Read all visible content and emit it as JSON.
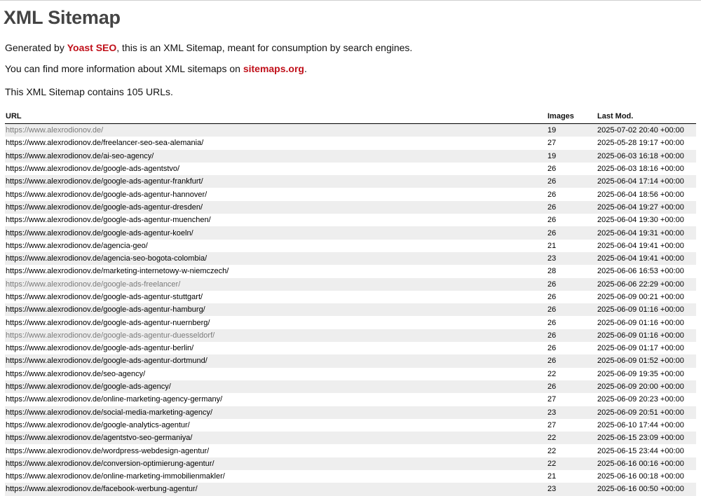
{
  "title": "XML Sitemap",
  "intro": {
    "generated_prefix": "Generated by ",
    "generator_link": "Yoast SEO",
    "generated_suffix": ", this is an XML Sitemap, meant for consumption by search engines.",
    "info_prefix": "You can find more information about XML sitemaps on ",
    "info_link": "sitemaps.org",
    "info_suffix": ".",
    "count_text": "This XML Sitemap contains 105 URLs."
  },
  "table": {
    "headers": {
      "url": "URL",
      "images": "Images",
      "lastmod": "Last Mod."
    },
    "rows": [
      {
        "url": "https://www.alexrodionov.de/",
        "images": "19",
        "lastmod": "2025-07-02 20:40 +00:00",
        "visited": true
      },
      {
        "url": "https://www.alexrodionov.de/freelancer-seo-sea-alemania/",
        "images": "27",
        "lastmod": "2025-05-28 19:17 +00:00",
        "visited": false
      },
      {
        "url": "https://www.alexrodionov.de/ai-seo-agency/",
        "images": "19",
        "lastmod": "2025-06-03 16:18 +00:00",
        "visited": false
      },
      {
        "url": "https://www.alexrodionov.de/google-ads-agentstvo/",
        "images": "26",
        "lastmod": "2025-06-03 18:16 +00:00",
        "visited": false
      },
      {
        "url": "https://www.alexrodionov.de/google-ads-agentur-frankfurt/",
        "images": "26",
        "lastmod": "2025-06-04 17:14 +00:00",
        "visited": false
      },
      {
        "url": "https://www.alexrodionov.de/google-ads-agentur-hannover/",
        "images": "26",
        "lastmod": "2025-06-04 18:56 +00:00",
        "visited": false
      },
      {
        "url": "https://www.alexrodionov.de/google-ads-agentur-dresden/",
        "images": "26",
        "lastmod": "2025-06-04 19:27 +00:00",
        "visited": false
      },
      {
        "url": "https://www.alexrodionov.de/google-ads-agentur-muenchen/",
        "images": "26",
        "lastmod": "2025-06-04 19:30 +00:00",
        "visited": false
      },
      {
        "url": "https://www.alexrodionov.de/google-ads-agentur-koeln/",
        "images": "26",
        "lastmod": "2025-06-04 19:31 +00:00",
        "visited": false
      },
      {
        "url": "https://www.alexrodionov.de/agencia-geo/",
        "images": "21",
        "lastmod": "2025-06-04 19:41 +00:00",
        "visited": false
      },
      {
        "url": "https://www.alexrodionov.de/agencia-seo-bogota-colombia/",
        "images": "23",
        "lastmod": "2025-06-04 19:41 +00:00",
        "visited": false
      },
      {
        "url": "https://www.alexrodionov.de/marketing-internetowy-w-niemczech/",
        "images": "28",
        "lastmod": "2025-06-06 16:53 +00:00",
        "visited": false
      },
      {
        "url": "https://www.alexrodionov.de/google-ads-freelancer/",
        "images": "26",
        "lastmod": "2025-06-06 22:29 +00:00",
        "visited": true
      },
      {
        "url": "https://www.alexrodionov.de/google-ads-agentur-stuttgart/",
        "images": "26",
        "lastmod": "2025-06-09 00:21 +00:00",
        "visited": false
      },
      {
        "url": "https://www.alexrodionov.de/google-ads-agentur-hamburg/",
        "images": "26",
        "lastmod": "2025-06-09 01:16 +00:00",
        "visited": false
      },
      {
        "url": "https://www.alexrodionov.de/google-ads-agentur-nuernberg/",
        "images": "26",
        "lastmod": "2025-06-09 01:16 +00:00",
        "visited": false
      },
      {
        "url": "https://www.alexrodionov.de/google-ads-agentur-duesseldorf/",
        "images": "26",
        "lastmod": "2025-06-09 01:16 +00:00",
        "visited": true
      },
      {
        "url": "https://www.alexrodionov.de/google-ads-agentur-berlin/",
        "images": "26",
        "lastmod": "2025-06-09 01:17 +00:00",
        "visited": false
      },
      {
        "url": "https://www.alexrodionov.de/google-ads-agentur-dortmund/",
        "images": "26",
        "lastmod": "2025-06-09 01:52 +00:00",
        "visited": false
      },
      {
        "url": "https://www.alexrodionov.de/seo-agency/",
        "images": "22",
        "lastmod": "2025-06-09 19:35 +00:00",
        "visited": false
      },
      {
        "url": "https://www.alexrodionov.de/google-ads-agency/",
        "images": "26",
        "lastmod": "2025-06-09 20:00 +00:00",
        "visited": false
      },
      {
        "url": "https://www.alexrodionov.de/online-marketing-agency-germany/",
        "images": "27",
        "lastmod": "2025-06-09 20:23 +00:00",
        "visited": false
      },
      {
        "url": "https://www.alexrodionov.de/social-media-marketing-agency/",
        "images": "23",
        "lastmod": "2025-06-09 20:51 +00:00",
        "visited": false
      },
      {
        "url": "https://www.alexrodionov.de/google-analytics-agentur/",
        "images": "27",
        "lastmod": "2025-06-10 17:44 +00:00",
        "visited": false
      },
      {
        "url": "https://www.alexrodionov.de/agentstvo-seo-germaniya/",
        "images": "22",
        "lastmod": "2025-06-15 23:09 +00:00",
        "visited": false
      },
      {
        "url": "https://www.alexrodionov.de/wordpress-webdesign-agentur/",
        "images": "22",
        "lastmod": "2025-06-15 23:44 +00:00",
        "visited": false
      },
      {
        "url": "https://www.alexrodionov.de/conversion-optimierung-agentur/",
        "images": "22",
        "lastmod": "2025-06-16 00:16 +00:00",
        "visited": false
      },
      {
        "url": "https://www.alexrodionov.de/online-marketing-immobilienmakler/",
        "images": "21",
        "lastmod": "2025-06-16 00:18 +00:00",
        "visited": false
      },
      {
        "url": "https://www.alexrodionov.de/facebook-werbung-agentur/",
        "images": "23",
        "lastmod": "2025-06-16 00:50 +00:00",
        "visited": false
      }
    ]
  },
  "colors": {
    "link_accent": "#c0101a",
    "title": "#444444",
    "row_stripe": "#eeeeee",
    "visited_link": "#7a7a7a"
  }
}
